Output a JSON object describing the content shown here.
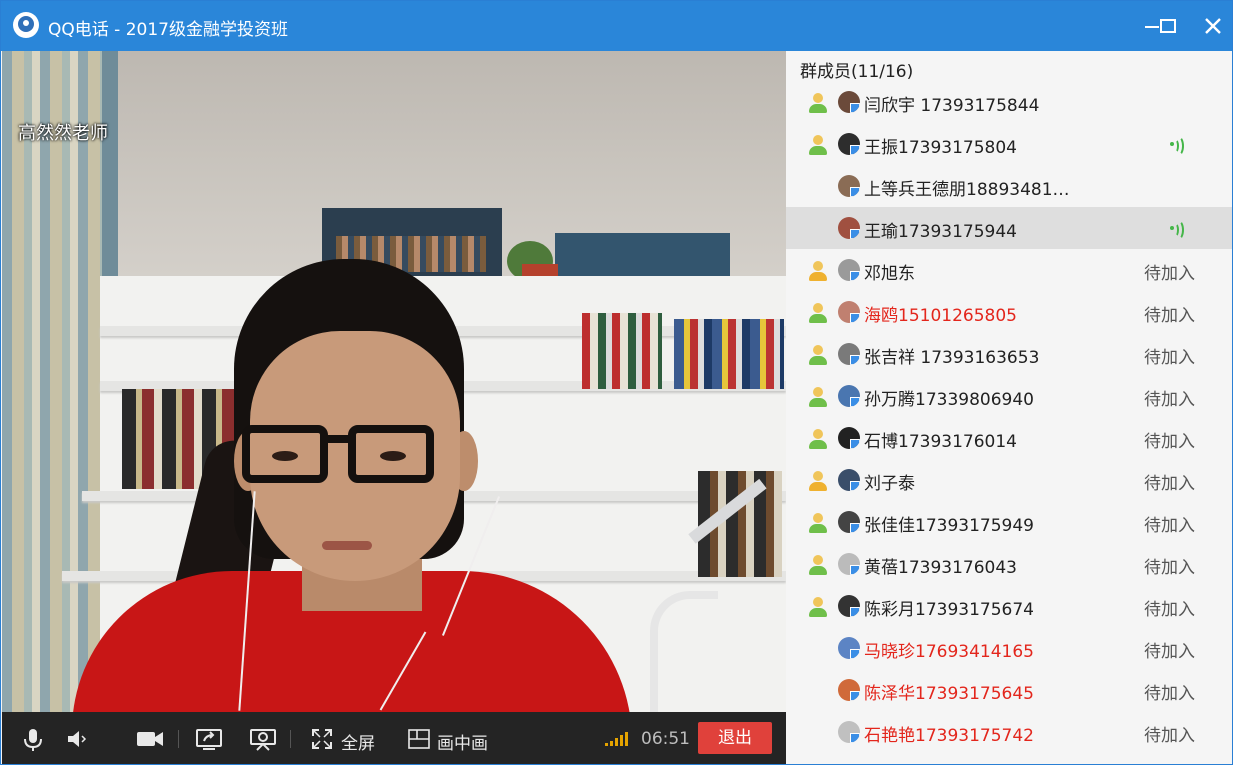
{
  "window": {
    "title": "QQ电话 - 2017级金融学投资班",
    "logo_icon": "qq-logo-icon"
  },
  "video": {
    "caller_name": "高然然老师"
  },
  "controls": {
    "fullscreen_label": "全屏",
    "pip_label": "画中画",
    "timer": "06:51",
    "exit_label": "退出",
    "exit_color": "#e0413b"
  },
  "panel": {
    "header": "群成员(11/16)",
    "members": [
      {
        "name": "闫欣宇   17393175844",
        "status": "",
        "speaking": false,
        "red": false,
        "icon": "green"
      },
      {
        "name": "王振17393175804",
        "status": "",
        "speaking": true,
        "red": false,
        "icon": "green"
      },
      {
        "name": "上等兵王德朋188934814…",
        "status": "",
        "speaking": false,
        "red": false,
        "icon": "none"
      },
      {
        "name": "王瑜17393175944",
        "status": "",
        "speaking": true,
        "red": false,
        "icon": "none",
        "selected": true
      },
      {
        "name": "邓旭东",
        "status": "待加入",
        "speaking": false,
        "red": false,
        "icon": "yellow"
      },
      {
        "name": "海鸥15101265805",
        "status": "待加入",
        "speaking": false,
        "red": true,
        "icon": "green"
      },
      {
        "name": "张吉祥 17393163653",
        "status": "待加入",
        "speaking": false,
        "red": false,
        "icon": "green"
      },
      {
        "name": "孙万腾17339806940",
        "status": "待加入",
        "speaking": false,
        "red": false,
        "icon": "green"
      },
      {
        "name": "石博17393176014",
        "status": "待加入",
        "speaking": false,
        "red": false,
        "icon": "green"
      },
      {
        "name": "刘子泰",
        "status": "待加入",
        "speaking": false,
        "red": false,
        "icon": "yellow"
      },
      {
        "name": "张佳佳17393175949",
        "status": "待加入",
        "speaking": false,
        "red": false,
        "icon": "green"
      },
      {
        "name": "黄蓓17393176043",
        "status": "待加入",
        "speaking": false,
        "red": false,
        "icon": "green"
      },
      {
        "name": "陈彩月17393175674",
        "status": "待加入",
        "speaking": false,
        "red": false,
        "icon": "green"
      },
      {
        "name": "马晓珍17693414165",
        "status": "待加入",
        "speaking": false,
        "red": true,
        "icon": "none"
      },
      {
        "name": "陈泽华17393175645",
        "status": "待加入",
        "speaking": false,
        "red": true,
        "icon": "none"
      },
      {
        "name": "石艳艳17393175742",
        "status": "待加入",
        "speaking": false,
        "red": true,
        "icon": "none"
      }
    ]
  },
  "colors": {
    "title_bar": "#2a86d9",
    "speaking_green": "#45b649",
    "name_red": "#e3261c"
  }
}
